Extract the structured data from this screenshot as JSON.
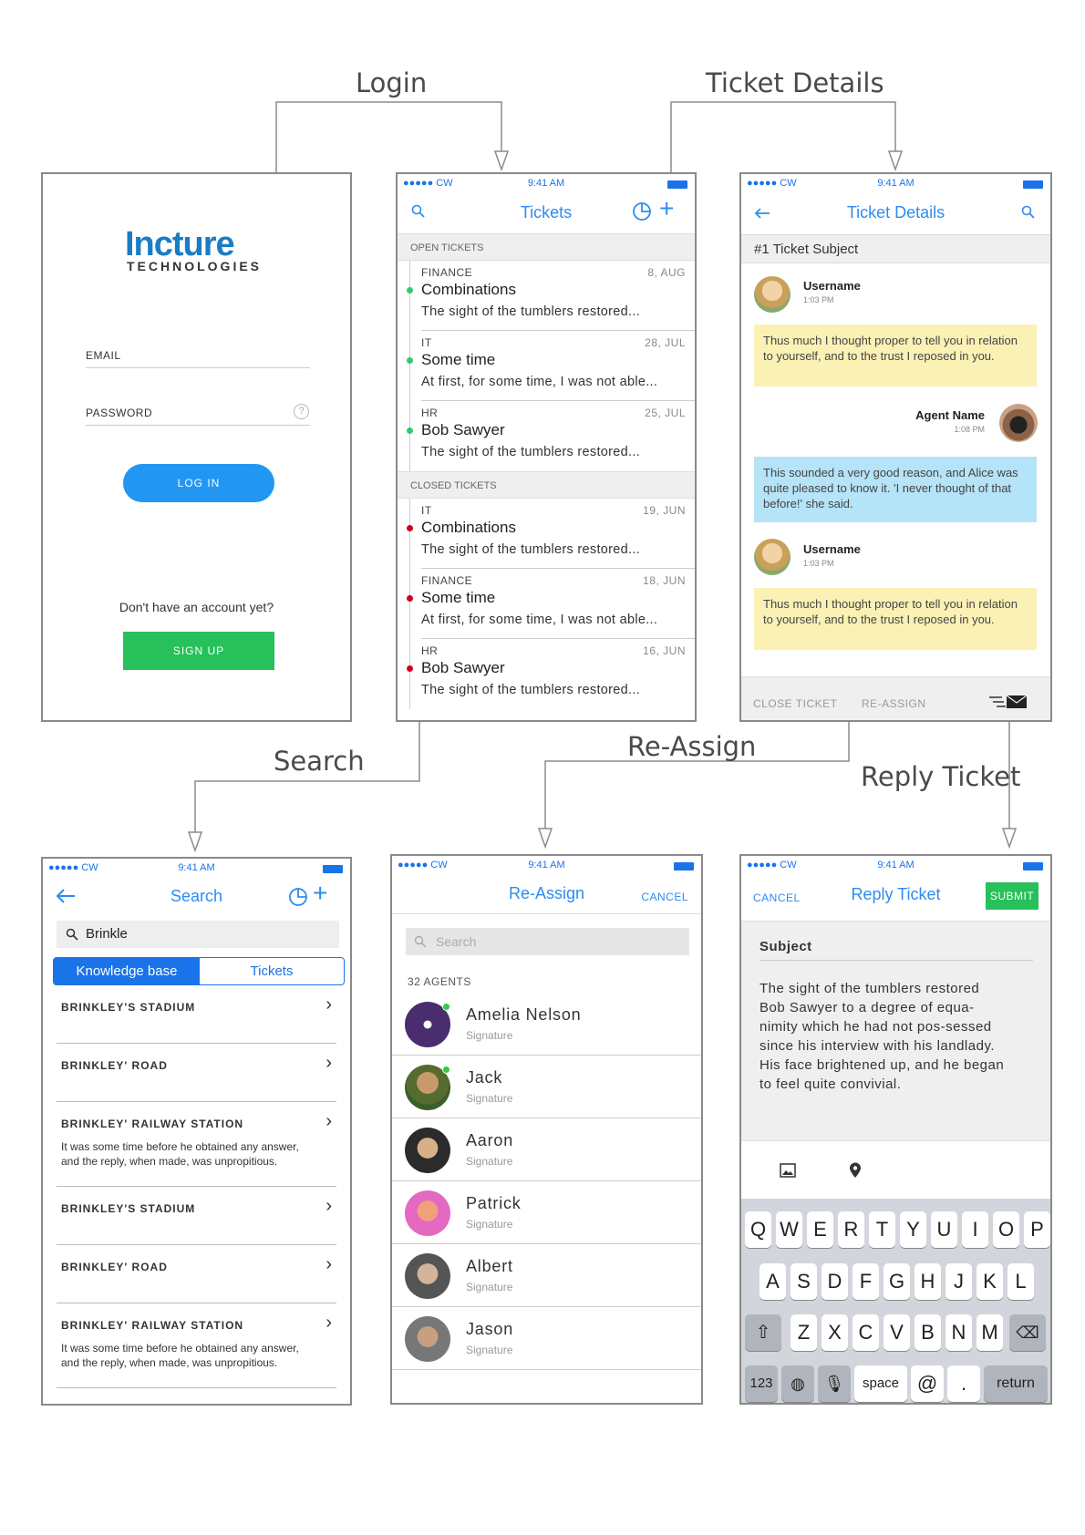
{
  "flow_labels": {
    "login": "Login",
    "ticket_details": "Ticket Details",
    "search": "Search",
    "reassign": "Re-Assign",
    "reply_ticket": "Reply Ticket"
  },
  "status_bar": {
    "carrier": "●●●●● CW",
    "time": "9:41 AM"
  },
  "login_screen": {
    "logo_main": "Incture",
    "logo_sub": "TECHNOLOGIES",
    "email_label": "EMAIL",
    "password_label": "PASSWORD",
    "help_icon": "?",
    "login_button": "LOG IN",
    "no_account": "Don't have an account yet?",
    "signup_button": "SIGN UP"
  },
  "tickets_screen": {
    "title": "Tickets",
    "open_label": "OPEN TICKETS",
    "closed_label": "CLOSED TICKETS",
    "open": [
      {
        "category": "FINANCE",
        "date": "8, AUG",
        "title": "Combinations",
        "snippet": "The sight of the tumblers restored..."
      },
      {
        "category": "IT",
        "date": "28, JUL",
        "title": "Some time",
        "snippet": "At first, for some time, I was not able..."
      },
      {
        "category": "HR",
        "date": "25, JUL",
        "title": "Bob Sawyer",
        "snippet": "The sight of the tumblers restored..."
      }
    ],
    "closed": [
      {
        "category": "IT",
        "date": "19, JUN",
        "title": "Combinations",
        "snippet": "The sight of the tumblers restored..."
      },
      {
        "category": "FINANCE",
        "date": "18, JUN",
        "title": "Some time",
        "snippet": "At first, for some time, I was not able..."
      },
      {
        "category": "HR",
        "date": "16, JUN",
        "title": "Bob Sawyer",
        "snippet": "The sight of the tumblers restored..."
      }
    ],
    "open_color": "#2ecc71",
    "closed_color": "#d0021b"
  },
  "details_screen": {
    "title": "Ticket Details",
    "subject": "#1 Ticket Subject",
    "messages": [
      {
        "name": "Username",
        "time": "1:03 PM",
        "text": "Thus much I thought proper to tell you in relation to yourself, and to the trust I reposed in you."
      },
      {
        "name": "Agent Name",
        "time": "1:08 PM",
        "text": "This sounded a very good reason, and Alice was quite pleased to know it. 'I never thought of that before!' she said."
      },
      {
        "name": "Username",
        "time": "1:03 PM",
        "text": "Thus much I thought proper to tell you in relation to yourself, and to the trust I reposed in you."
      }
    ],
    "close_ticket": "CLOSE TICKET",
    "reassign": "RE-ASSIGN"
  },
  "search_screen": {
    "title": "Search",
    "query": "Brinkle",
    "tab_kb": "Knowledge base",
    "tab_tickets": "Tickets",
    "results": [
      {
        "title": "BRINKLEY'S STADIUM",
        "desc": ""
      },
      {
        "title": "BRINKLEY' ROAD",
        "desc": ""
      },
      {
        "title": "BRINKLEY' RAILWAY STATION",
        "desc": "It was some time before he obtained any answer, and the reply, when made, was unpropitious."
      },
      {
        "title": "BRINKLEY'S STADIUM",
        "desc": ""
      },
      {
        "title": "BRINKLEY' ROAD",
        "desc": ""
      },
      {
        "title": "BRINKLEY' RAILWAY STATION",
        "desc": "It was some time before he obtained any answer, and the reply, when made, was unpropitious."
      }
    ]
  },
  "reassign_screen": {
    "title": "Re-Assign",
    "cancel": "CANCEL",
    "search_placeholder": "Search",
    "count": "32 AGENTS",
    "agents": [
      {
        "name": "Amelia Nelson",
        "sig": "Signature"
      },
      {
        "name": "Jack",
        "sig": "Signature"
      },
      {
        "name": "Aaron",
        "sig": "Signature"
      },
      {
        "name": "Patrick",
        "sig": "Signature"
      },
      {
        "name": "Albert",
        "sig": "Signature"
      },
      {
        "name": "Jason",
        "sig": "Signature"
      }
    ]
  },
  "reply_screen": {
    "cancel": "CANCEL",
    "title": "Reply Ticket",
    "submit": "SUBMIT",
    "subject_label": "Subject",
    "body": "The sight of the tumblers restored Bob Sawyer to a degree of equa-nimity which he had not pos-sessed since his interview with his landlady. His face brightened up, and he began to feel quite convivial.",
    "keyboard": {
      "row1": [
        "Q",
        "W",
        "E",
        "R",
        "T",
        "Y",
        "U",
        "I",
        "O",
        "P"
      ],
      "row2": [
        "A",
        "S",
        "D",
        "F",
        "G",
        "H",
        "J",
        "K",
        "L"
      ],
      "row3": [
        "Z",
        "X",
        "C",
        "V",
        "B",
        "N",
        "M"
      ],
      "num": "123",
      "space": "space",
      "at": "@",
      "dot": ".",
      "ret": "return"
    }
  }
}
